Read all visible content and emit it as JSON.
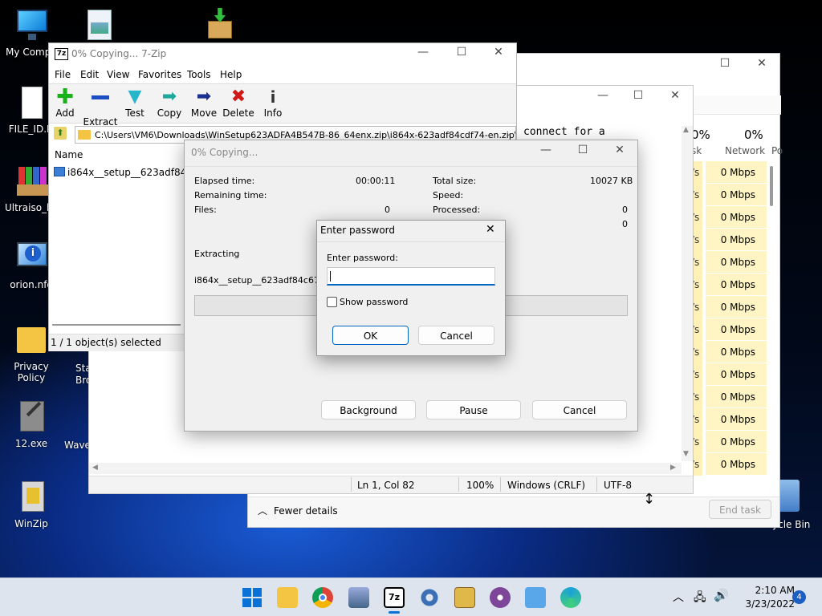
{
  "desktop": {
    "icons": [
      "My Compu",
      "FILE_ID.D",
      "Ultraiso_ke",
      "orion.nfo",
      "Privacy Policy",
      "12.exe",
      "WinZip",
      "Sta",
      "Bro",
      "Wave",
      "ycle Bin"
    ]
  },
  "taskmanager": {
    "cpu_pct": "0%",
    "network_pct": "0%",
    "network_label": "Network",
    "disk_cut": "sk",
    "power_cut": "Po",
    "row_value": "0 Mbps",
    "row_cut": "/s",
    "rows": 14,
    "fewer_details": "Fewer details",
    "end_task": "End task"
  },
  "notepad": {
    "text_fragment": "connect for a",
    "status": {
      "position": "Ln 1, Col 82",
      "zoom": "100%",
      "eol": "Windows (CRLF)",
      "encoding": "UTF-8"
    }
  },
  "zip": {
    "title": "0% Copying... 7-Zip",
    "menu": [
      "File",
      "Edit",
      "View",
      "Favorites",
      "Tools",
      "Help"
    ],
    "toolbar": [
      "Add",
      "Extract",
      "Test",
      "Copy",
      "Move",
      "Delete",
      "Info"
    ],
    "path": "C:\\Users\\VM6\\Downloads\\WinSetup623ADFA4B547B-86_64enx.zip\\i864x-623adf84cdf74-en.zip\\",
    "column_name": "Name",
    "file_name": "i864x__setup__623adf84...",
    "status": "1 / 1 object(s) selected"
  },
  "copying": {
    "title": "0% Copying...",
    "elapsed_label": "Elapsed time:",
    "elapsed_value": "00:00:11",
    "remaining_label": "Remaining time:",
    "files_label": "Files:",
    "files_value": "0",
    "total_label": "Total size:",
    "total_value": "10027 KB",
    "speed_label": "Speed:",
    "processed_label": "Processed:",
    "processed_value": "0",
    "extra_value": "0",
    "extracting_label": "Extracting",
    "current_file": "i864x__setup__623adf84c678f.e",
    "progress": 0,
    "buttons": {
      "background": "Background",
      "pause": "Pause",
      "cancel": "Cancel"
    }
  },
  "password": {
    "title": "Enter password",
    "label": "Enter password:",
    "value": "",
    "show_label": "Show password",
    "ok": "OK",
    "cancel": "Cancel"
  },
  "taskbar": {
    "time": "2:10 AM",
    "date": "3/23/2022",
    "notifications": "4"
  }
}
